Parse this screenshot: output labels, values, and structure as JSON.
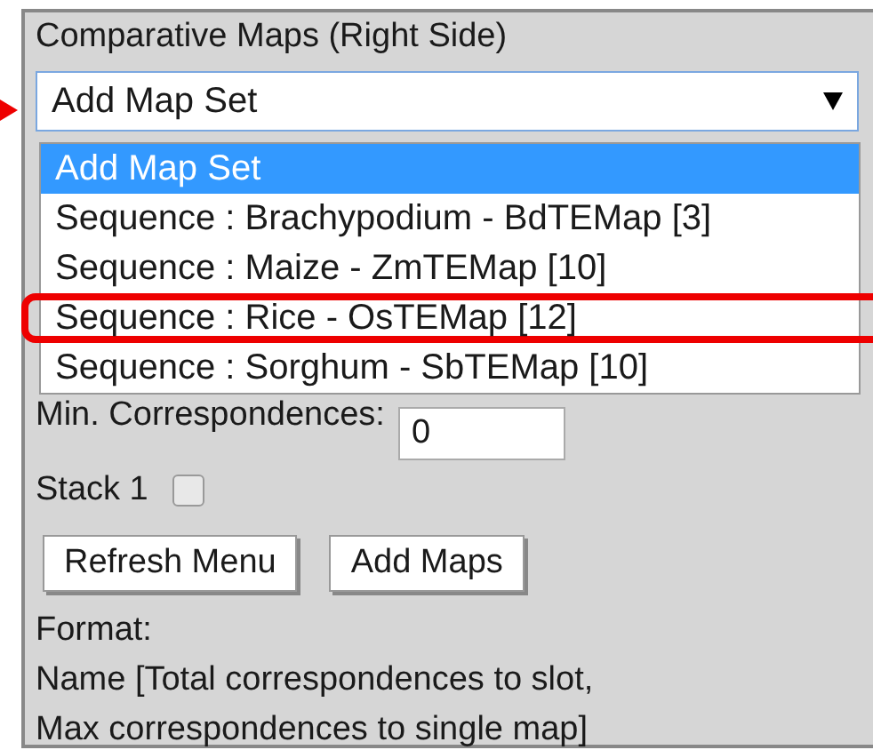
{
  "panel": {
    "title": "Comparative Maps (Right Side)",
    "select": {
      "value": "Add Map Set",
      "expanded": true,
      "options": [
        {
          "label": "Add Map Set",
          "selected": true,
          "highlighted": false
        },
        {
          "label": "Sequence : Brachypodium - BdTEMap [3]",
          "selected": false,
          "highlighted": false
        },
        {
          "label": "Sequence : Maize - ZmTEMap [10]",
          "selected": false,
          "highlighted": false
        },
        {
          "label": "Sequence : Rice - OsTEMap [12]",
          "selected": false,
          "highlighted": true
        },
        {
          "label": "Sequence : Sorghum - SbTEMap [10]",
          "selected": false,
          "highlighted": false
        }
      ]
    },
    "min_correspondences": {
      "label": "Min. Correspondences:",
      "value": "0"
    },
    "stack": {
      "label": "Stack 1",
      "checked": false
    },
    "buttons": [
      "Refresh Menu",
      "Add Maps"
    ],
    "format": [
      "Format:",
      "Name [Total correspondences to slot,",
      "Max correspondences to single map]"
    ]
  }
}
